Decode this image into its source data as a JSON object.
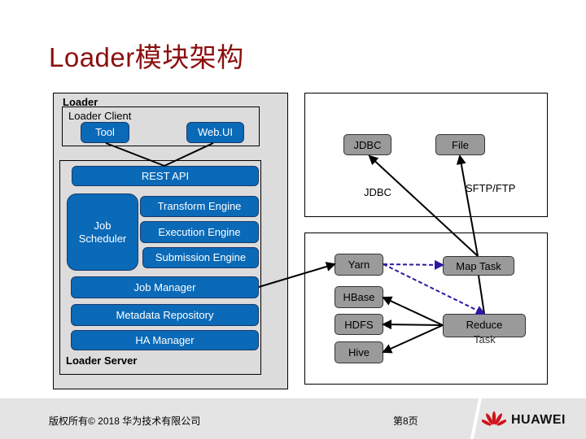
{
  "title": "Loader模块架构",
  "loader": {
    "label": "Loader",
    "client": {
      "label": "Loader Client",
      "tool": "Tool",
      "webui": "Web.UI"
    },
    "server": {
      "label": "Loader Server",
      "rest_api": "REST API",
      "job_scheduler": "Job\nScheduler",
      "transform_engine": "Transform Engine",
      "execution_engine": "Execution Engine",
      "submission_engine": "Submission Engine",
      "job_manager": "Job Manager",
      "metadata_repository": "Metadata Repository",
      "ha_manager": "HA Manager"
    }
  },
  "external": {
    "jdbc_node": "JDBC",
    "file_node": "File",
    "jdbc_link_label": "JDBC",
    "sftp_link_label": "SFTP/FTP"
  },
  "cluster": {
    "yarn": "Yarn",
    "map_task": "Map Task",
    "hbase": "HBase",
    "hdfs": "HDFS",
    "hive": "Hive",
    "reduce_task_line1": "Reduce",
    "reduce_task_line2": "Task"
  },
  "colors": {
    "title": "#8b0f0f",
    "component_blue": "#0a6ab8",
    "node_gray": "#9a9a9a",
    "panel_gray": "#dcdcdc",
    "dashed_link": "#2a1aa0"
  },
  "footer": {
    "copyright": "版权所有© 2018 华为技术有限公司",
    "page": "第8页",
    "brand": "HUAWEI"
  }
}
